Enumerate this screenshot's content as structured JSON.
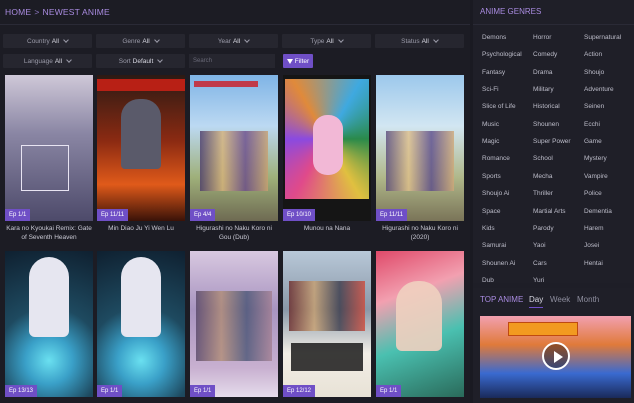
{
  "breadcrumb": {
    "home": "HOME",
    "separator": ">",
    "current": "NEWEST ANIME"
  },
  "filters": [
    {
      "label": "Country",
      "value": "All"
    },
    {
      "label": "Genre",
      "value": "All"
    },
    {
      "label": "Year",
      "value": "All"
    },
    {
      "label": "Type",
      "value": "All"
    },
    {
      "label": "Status",
      "value": "All"
    },
    {
      "label": "Language",
      "value": "All"
    },
    {
      "label": "Sort",
      "value": "Default"
    }
  ],
  "search": {
    "placeholder": "Search"
  },
  "filter_button": {
    "label": "Filter"
  },
  "cards": [
    {
      "ep": "Ep 1/1",
      "title": "Kara no Kyoukai Remix: Gate of Seventh Heaven"
    },
    {
      "ep": "Ep 11/11",
      "title": "Min Diao Ju Yi Wen Lu"
    },
    {
      "ep": "Ep 4/4",
      "title": "Higurashi no Naku Koro ni Gou (Dub)"
    },
    {
      "ep": "Ep 10/10",
      "title": "Munou na Nana"
    },
    {
      "ep": "Ep 11/11",
      "title": "Higurashi no Naku Koro ni (2020)"
    },
    {
      "ep": "Ep 13/13",
      "title": ""
    },
    {
      "ep": "Ep 1/1",
      "title": ""
    },
    {
      "ep": "Ep 1/1",
      "title": ""
    },
    {
      "ep": "Ep 12/12",
      "title": ""
    },
    {
      "ep": "Ep 1/1",
      "title": ""
    }
  ],
  "sidebar": {
    "genres_title": "ANIME GENRES",
    "genres": [
      "Demons",
      "Horror",
      "Supernatural",
      "Psychological",
      "Comedy",
      "Action",
      "Fantasy",
      "Drama",
      "Shoujo",
      "Sci-Fi",
      "Military",
      "Adventure",
      "Slice of Life",
      "Historical",
      "Seinen",
      "Music",
      "Shounen",
      "Ecchi",
      "Magic",
      "Super Power",
      "Game",
      "Romance",
      "School",
      "Mystery",
      "Sports",
      "Mecha",
      "Vampire",
      "Shoujo Ai",
      "Thriller",
      "Police",
      "Space",
      "Martial Arts",
      "Dementia",
      "Kids",
      "Parody",
      "Harem",
      "Samurai",
      "Yaoi",
      "Josei",
      "Shounen Ai",
      "Cars",
      "Hentai",
      "Dub",
      "Yuri"
    ],
    "top_title": "TOP ANIME",
    "top_tabs": [
      "Day",
      "Week",
      "Month"
    ]
  },
  "colors": {
    "accent": "#6f4fc6",
    "heading": "#a98be0",
    "background": "#1a1a22"
  },
  "icons": {
    "filter_icon": "funnel-icon",
    "play_icon": "play-icon",
    "dropdown": "chevron-down-icon"
  }
}
